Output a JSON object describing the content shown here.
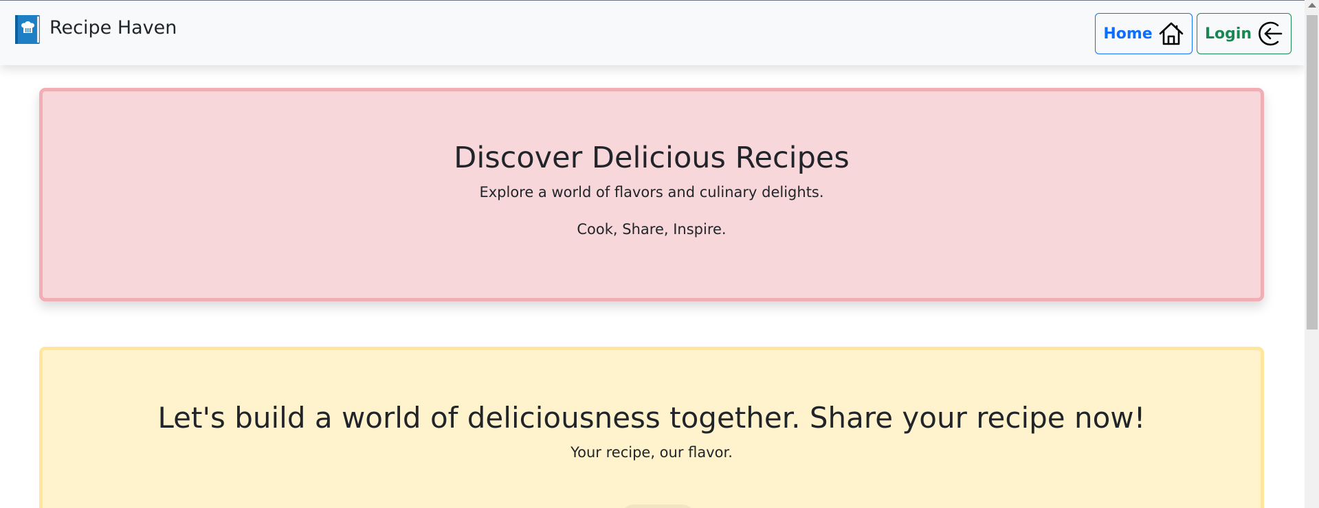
{
  "navbar": {
    "brand_name": "Recipe Haven",
    "brand_icon": "book-icon",
    "home_label": "Home",
    "home_icon": "house-icon",
    "login_label": "Login",
    "login_icon": "login-arrow-icon"
  },
  "hero": {
    "title": "Discover Delicious Recipes",
    "subtitle": "Explore a world of flavors and culinary delights.",
    "tagline": "Cook, Share, Inspire."
  },
  "share": {
    "title": "Let's build a world of deliciousness together. Share your recipe now!",
    "subtitle": "Your recipe, our flavor."
  },
  "colors": {
    "primary": "#0d6efd",
    "success": "#198754",
    "hero_bg": "#f8d7da",
    "hero_border": "#f1aeb5",
    "share_bg": "#fff3cd",
    "share_border": "#ffe69c",
    "navbar_bg": "#f8f9fa"
  }
}
